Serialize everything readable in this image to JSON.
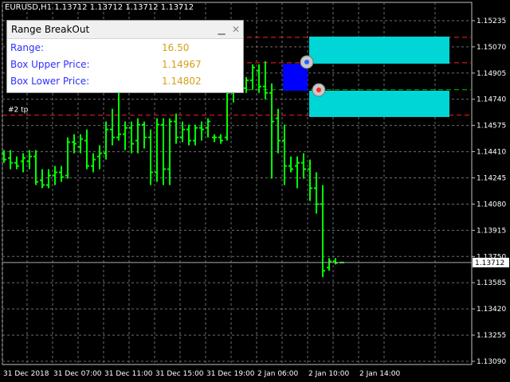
{
  "window_title": "EURUSD,H1  1.13712 1.13712 1.13712 1.13712",
  "panel": {
    "title": "Range BreakOut",
    "minimize_icon": "minimize-icon",
    "close_icon": "close-icon",
    "rows": [
      {
        "label": "Range:",
        "value": "16.50"
      },
      {
        "label": "Box Upper Price:",
        "value": "1.14967"
      },
      {
        "label": "Box Lower Price:",
        "value": "1.14802"
      }
    ]
  },
  "colors": {
    "background": "#000000",
    "bars": "#00ff00",
    "grid": "#6e6e6e",
    "box": "#00d6d6",
    "range_box": "#0000ff",
    "level_line": "#ff2020",
    "panel_label": "#2f2fff",
    "panel_value": "#d4a017"
  },
  "chart_data": {
    "type": "ohlc",
    "symbol": "EURUSD",
    "timeframe": "H1",
    "ylim": [
      1.1307,
      1.1535
    ],
    "y_ticks": [
      "1.15235",
      "1.15070",
      "1.14905",
      "1.14740",
      "1.14575",
      "1.14410",
      "1.14245",
      "1.14080",
      "1.13915",
      "1.13750",
      "1.13585",
      "1.13420",
      "1.13255",
      "1.13090"
    ],
    "x_ticks": [
      "31 Dec 2018",
      "31 Dec 07:00",
      "31 Dec 11:00",
      "31 Dec 15:00",
      "31 Dec 19:00",
      "2 Jan 06:00",
      "2 Jan 10:00",
      "2 Jan 14:00"
    ],
    "current_price": "1.13712",
    "level_label": "#2 tp",
    "levels": {
      "dash1": 1.1513,
      "dash2": 1.1497,
      "dash3": 1.148,
      "dash4": 1.1464
    },
    "bars": [
      [
        1.144,
        1.1442,
        1.1434,
        1.1436
      ],
      [
        1.1437,
        1.1442,
        1.143,
        1.1434
      ],
      [
        1.1434,
        1.1438,
        1.143,
        1.1432
      ],
      [
        1.1435,
        1.144,
        1.1428,
        1.1437
      ],
      [
        1.1435,
        1.1442,
        1.143,
        1.1438
      ],
      [
        1.1438,
        1.1442,
        1.142,
        1.1422
      ],
      [
        1.1423,
        1.143,
        1.1418,
        1.142
      ],
      [
        1.142,
        1.143,
        1.1418,
        1.1426
      ],
      [
        1.1426,
        1.1432,
        1.142,
        1.1428
      ],
      [
        1.1428,
        1.1432,
        1.1422,
        1.1425
      ],
      [
        1.1426,
        1.145,
        1.1424,
        1.1447
      ],
      [
        1.1447,
        1.1452,
        1.144,
        1.1446
      ],
      [
        1.1444,
        1.1452,
        1.144,
        1.1449
      ],
      [
        1.1448,
        1.1455,
        1.143,
        1.1432
      ],
      [
        1.1432,
        1.144,
        1.1428,
        1.1436
      ],
      [
        1.1438,
        1.1445,
        1.143,
        1.144
      ],
      [
        1.144,
        1.146,
        1.1436,
        1.1455
      ],
      [
        1.1455,
        1.1468,
        1.1445,
        1.145
      ],
      [
        1.145,
        1.148,
        1.1448,
        1.1452
      ],
      [
        1.1452,
        1.146,
        1.1442,
        1.1456
      ],
      [
        1.1456,
        1.146,
        1.144,
        1.1446
      ],
      [
        1.1448,
        1.1462,
        1.144,
        1.1458
      ],
      [
        1.1458,
        1.146,
        1.1443,
        1.145
      ],
      [
        1.145,
        1.1455,
        1.142,
        1.1428
      ],
      [
        1.1428,
        1.1462,
        1.1422,
        1.1458
      ],
      [
        1.1458,
        1.1462,
        1.142,
        1.143
      ],
      [
        1.143,
        1.1462,
        1.142,
        1.146
      ],
      [
        1.146,
        1.1465,
        1.1446,
        1.145
      ],
      [
        1.145,
        1.146,
        1.1447,
        1.1455
      ],
      [
        1.1455,
        1.1458,
        1.1445,
        1.1448
      ],
      [
        1.1448,
        1.1458,
        1.1445,
        1.1456
      ],
      [
        1.1456,
        1.146,
        1.1448,
        1.1455
      ],
      [
        1.1456,
        1.1462,
        1.145,
        1.146
      ],
      [
        1.145,
        1.1452,
        1.1447,
        1.145
      ],
      [
        1.145,
        1.1452,
        1.1446,
        1.1448
      ],
      [
        1.145,
        1.148,
        1.1448,
        1.1478
      ],
      [
        1.1478,
        1.1482,
        1.1472,
        1.148
      ],
      [
        1.148,
        1.1484,
        1.1478,
        1.1481
      ],
      [
        1.1481,
        1.1488,
        1.1478,
        1.1486
      ],
      [
        1.1486,
        1.1496,
        1.148,
        1.1494
      ],
      [
        1.1492,
        1.1496,
        1.1478,
        1.1482
      ],
      [
        1.1482,
        1.1498,
        1.1474,
        1.1478
      ],
      [
        1.1478,
        1.1484,
        1.1424,
        1.146
      ],
      [
        1.1462,
        1.1468,
        1.144,
        1.1448
      ],
      [
        1.1448,
        1.1458,
        1.142,
        1.1432
      ],
      [
        1.1432,
        1.1438,
        1.1428,
        1.143
      ],
      [
        1.1432,
        1.1438,
        1.1418,
        1.1434
      ],
      [
        1.1434,
        1.144,
        1.1424,
        1.143
      ],
      [
        1.143,
        1.1436,
        1.141,
        1.1418
      ],
      [
        1.1418,
        1.1428,
        1.1402,
        1.1408
      ],
      [
        1.1408,
        1.142,
        1.1362,
        1.1366
      ],
      [
        1.1368,
        1.1374,
        1.1366,
        1.1372
      ],
      [
        1.1372,
        1.1374,
        1.137,
        1.1371
      ],
      [
        1.13712,
        1.13712,
        1.13712,
        1.13712
      ]
    ]
  }
}
